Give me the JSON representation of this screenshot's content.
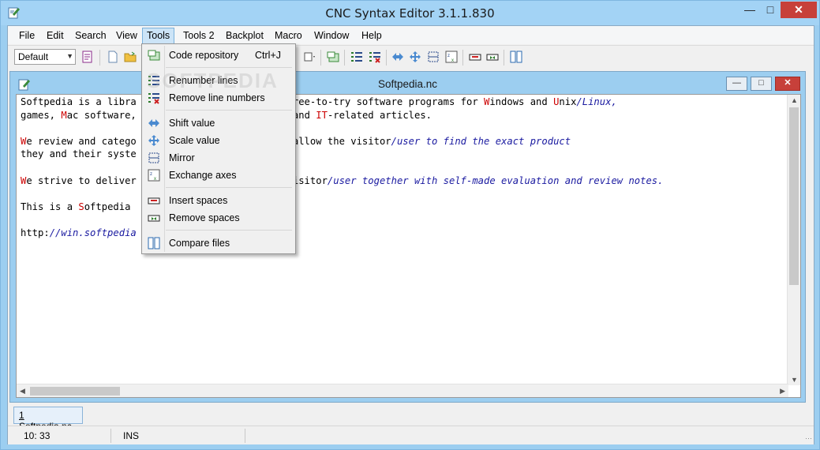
{
  "window": {
    "title": "CNC Syntax Editor 3.1.1.830"
  },
  "menubar": {
    "items": [
      "File",
      "Edit",
      "Search",
      "View",
      "Tools",
      "Tools 2",
      "Backplot",
      "Macro",
      "Window",
      "Help"
    ],
    "active": "Tools"
  },
  "toolbar": {
    "style_combo": "Default"
  },
  "document": {
    "title": "Softpedia.nc",
    "lines": [
      [
        {
          "t": "Softpedia is a libra"
        },
        {
          "t": "                    e and free-to-try software programs for "
        },
        {
          "t": "W",
          "c": "kw"
        },
        {
          "t": "indows and "
        },
        {
          "t": "U",
          "c": "kw"
        },
        {
          "t": "nix"
        },
        {
          "t": "/Linux,",
          "c": "it"
        }
      ],
      [
        {
          "t": "games, "
        },
        {
          "t": "M",
          "c": "kw"
        },
        {
          "t": "ac software,"
        },
        {
          "t": "                   devices and "
        },
        {
          "t": "IT",
          "c": "kw"
        },
        {
          "t": "-related articles."
        }
      ],
      [],
      [
        {
          "t": "W",
          "c": "kw"
        },
        {
          "t": "e review and catego"
        },
        {
          "t": "                   rder to allow the visitor"
        },
        {
          "t": "/user to find the exact product",
          "c": "it"
        }
      ],
      [
        {
          "t": "they and their syste"
        }
      ],
      [],
      [
        {
          "t": "W",
          "c": "kw"
        },
        {
          "t": "e strive to deliver"
        },
        {
          "t": "                   to the visitor"
        },
        {
          "t": "/user together with self-made evaluation and review notes.",
          "c": "it"
        }
      ],
      [],
      [
        {
          "t": "This is a "
        },
        {
          "t": "S",
          "c": "kw"
        },
        {
          "t": "oftpedia"
        }
      ],
      [],
      [
        {
          "t": "http:"
        },
        {
          "t": "//win.softpedia",
          "c": "it"
        }
      ]
    ]
  },
  "tools_menu": {
    "items": [
      {
        "label": "Code repository",
        "shortcut": "Ctrl+J",
        "icon": "code-repository-icon"
      },
      {
        "label": "Renumber lines",
        "icon": "renumber-lines-icon"
      },
      {
        "label": "Remove line numbers",
        "icon": "remove-line-numbers-icon"
      },
      {
        "label": "Shift value",
        "icon": "shift-value-icon"
      },
      {
        "label": "Scale value",
        "icon": "scale-value-icon"
      },
      {
        "label": "Mirror",
        "icon": "mirror-icon"
      },
      {
        "label": "Exchange axes",
        "icon": "exchange-axes-icon"
      },
      {
        "label": "Insert spaces",
        "icon": "insert-spaces-icon"
      },
      {
        "label": "Remove spaces",
        "icon": "remove-spaces-icon"
      },
      {
        "label": "Compare files",
        "icon": "compare-files-icon"
      }
    ]
  },
  "tabs": [
    {
      "prefix": "1",
      "label": "Softpedia.nc"
    }
  ],
  "status": {
    "position": "10: 33",
    "mode": "INS"
  },
  "watermark": "SOFTPEDIA",
  "colors": {
    "accent": "#9ccef0",
    "close": "#c7403a",
    "keyword": "#cc0000",
    "comment": "#1a1aa0"
  }
}
